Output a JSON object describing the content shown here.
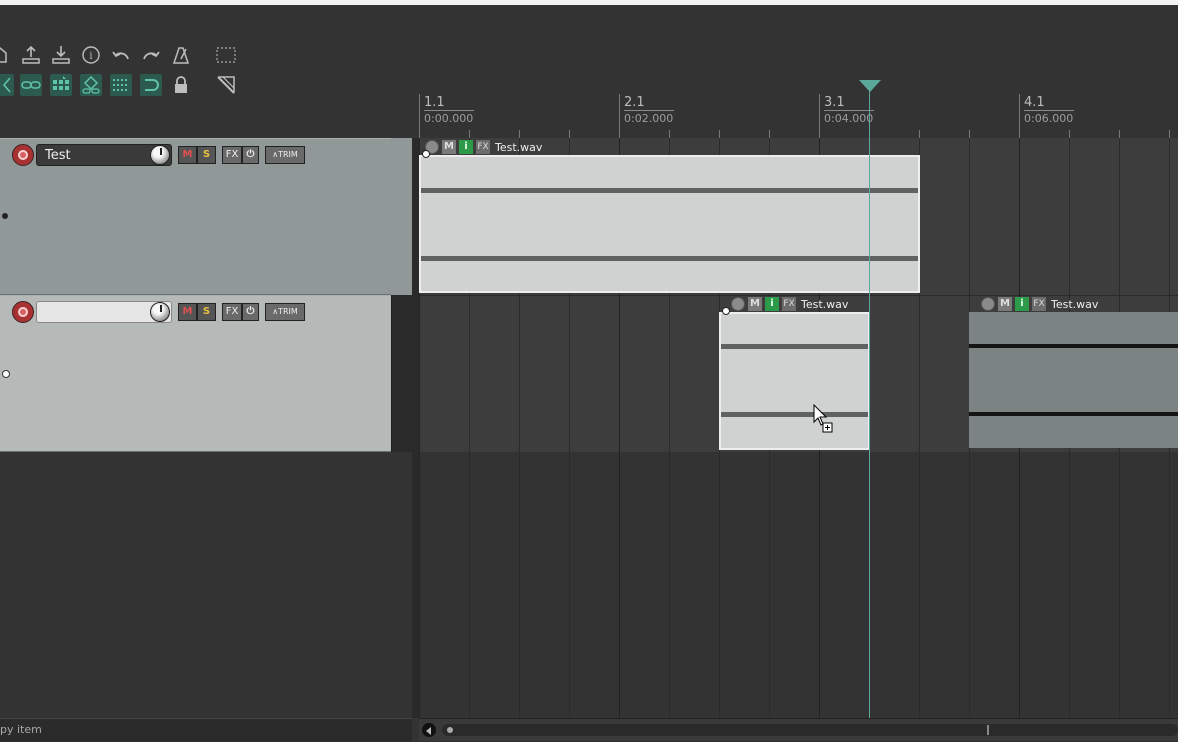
{
  "colors": {
    "background": "#333333",
    "playhead": "#5aa89a",
    "toolbar_active": "#2d5a4f",
    "item_selected": "#cfd2d1",
    "item_unselected": "#7c8483"
  },
  "toolbar": {
    "row1_icons": [
      "home-icon",
      "render-upload-icon",
      "download-icon",
      "info-icon",
      "undo-icon",
      "redo-icon",
      "metronome-icon"
    ],
    "row2_icons": [
      "ripple-icon",
      "link-icon",
      "snap-grid-icon",
      "group-icon",
      "grid-icon",
      "loop-icon",
      "lock-icon"
    ],
    "extra_icons": [
      "marquee-icon",
      "envelope-icon"
    ]
  },
  "tracks": [
    {
      "name": "Test",
      "mute_label": "M",
      "solo_label": "S",
      "fx_label": "FX",
      "trim_label": "TRIM",
      "selected": false
    },
    {
      "name": "",
      "mute_label": "M",
      "solo_label": "S",
      "fx_label": "FX",
      "trim_label": "TRIM",
      "selected": true
    }
  ],
  "ruler": {
    "markers": [
      {
        "measure": "1.1",
        "time": "0:00.000"
      },
      {
        "measure": "2.1",
        "time": "0:02.000"
      },
      {
        "measure": "3.1",
        "time": "0:04.000"
      },
      {
        "measure": "4.1",
        "time": "0:06.000"
      }
    ]
  },
  "items": [
    {
      "track": 1,
      "name": "Test.wav",
      "start": "0:00.000",
      "end": "0:05.000",
      "selected": true,
      "m_label": "M",
      "i_label": "i",
      "fx_label": "FX"
    },
    {
      "track": 2,
      "name": "Test.wav",
      "start": "0:03.000",
      "end": "0:04.500",
      "selected": true,
      "m_label": "M",
      "i_label": "i",
      "fx_label": "FX"
    },
    {
      "track": 2,
      "name": "Test.wav",
      "start": "0:05.500",
      "end": "0:07.600",
      "selected": false,
      "m_label": "M",
      "i_label": "i",
      "fx_label": "FX"
    }
  ],
  "playhead": {
    "time": "0:04.500"
  },
  "status": {
    "text": "py item"
  }
}
